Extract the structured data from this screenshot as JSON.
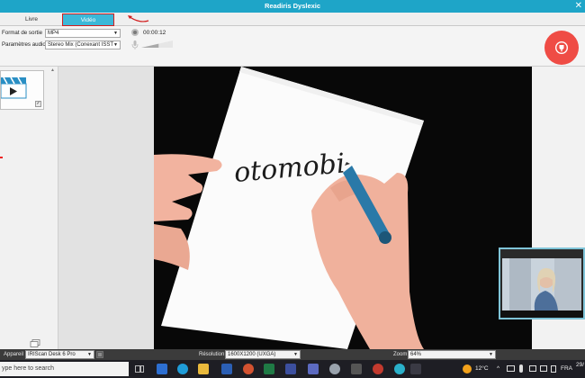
{
  "window": {
    "title": "Readiris Dyslexic",
    "close_glyph": "✕"
  },
  "tabs": [
    {
      "label": "Livre"
    },
    {
      "label": "Vidéo",
      "selected": true
    }
  ],
  "settings": {
    "format_label": "Format de sortie",
    "format_value": "MP4",
    "audio_label": "Paramètres audio",
    "audio_value": "Stereo Mix (Conexant ISST",
    "timer": "00:00:12",
    "volume_level": 0.55
  },
  "video": {
    "handwritten_text": "otomobi"
  },
  "statusbar": {
    "device_label": "Appareil",
    "device_value": "IRIScan Desk 6 Pro",
    "resolution_label": "Résolution",
    "resolution_value": "1600X1200 (UXGA)",
    "zoom_label": "Zoom",
    "zoom_value": "64%"
  },
  "taskbar": {
    "search_text": "ype here to search",
    "temperature": "12°C",
    "language": "FRA",
    "date_fragment": "29/"
  },
  "colors": {
    "title_bg": "#1ea5c8",
    "tab_selected_bg": "#3bb8d8",
    "annotation_red": "#d21e1e",
    "record_button": "#ef4c45"
  },
  "icons": [
    "record-indicator-icon",
    "microphone-icon",
    "record-icon",
    "video-clapper-icon",
    "pages-icon",
    "windows-taskbar-icons"
  ]
}
